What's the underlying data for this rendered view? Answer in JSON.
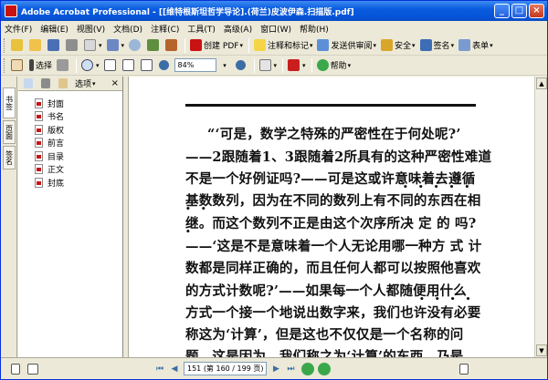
{
  "window": {
    "title": "Adobe Acrobat Professional - [[维特根斯坦哲学导论].(荷兰)皮波伊森.扫描版.pdf]",
    "minimize": "_",
    "maximize": "□",
    "close": "×"
  },
  "menu": [
    "文件(F)",
    "编辑(E)",
    "视图(V)",
    "文档(D)",
    "注释(C)",
    "工具(T)",
    "高级(A)",
    "窗口(W)",
    "帮助(H)"
  ],
  "toolbar1": {
    "create_pdf": "创建 PDF",
    "comment": "注释和标记",
    "send_review": "发送供审阅",
    "secure": "安全",
    "sign": "签名",
    "forms": "表单"
  },
  "toolbar2": {
    "select": "选择",
    "zoom": "84%",
    "help": "帮助"
  },
  "left_tabs": [
    "书签",
    "页面",
    "签名"
  ],
  "panel": {
    "options": "选项",
    "bookmarks": [
      "封面",
      "书名",
      "版权",
      "前言",
      "目录",
      "正文",
      "封底"
    ]
  },
  "document": {
    "lines": [
      "“‘可是，数学之特殊的严密性在于何处呢?’",
      "——2跟随着1、3跟随着2所具有的这种严密性难道",
      "不是一个好例证吗?——可是这或许意味着去遵循",
      "基数数列，因为在不同的数列上有不同的东西在相",
      "继。而这个数列不正是由这个次序所决 定 的 吗?",
      "——‘这是不是意味着一个人无论用哪一种方 式 计",
      "数都是同样正确的，而且任何人都可以按照他喜欢",
      "的方式计数呢?’——如果每一个人都随便用什么",
      "方式一个接一个地说出数字来，我们也许没有必要",
      "称这为‘计算’，但是这也不仅仅是一个名称的问",
      "题。这是因为，我们称之为‘计算’的东西，乃是"
    ]
  },
  "status": {
    "page": "151 (第 160 / 199 页)"
  }
}
